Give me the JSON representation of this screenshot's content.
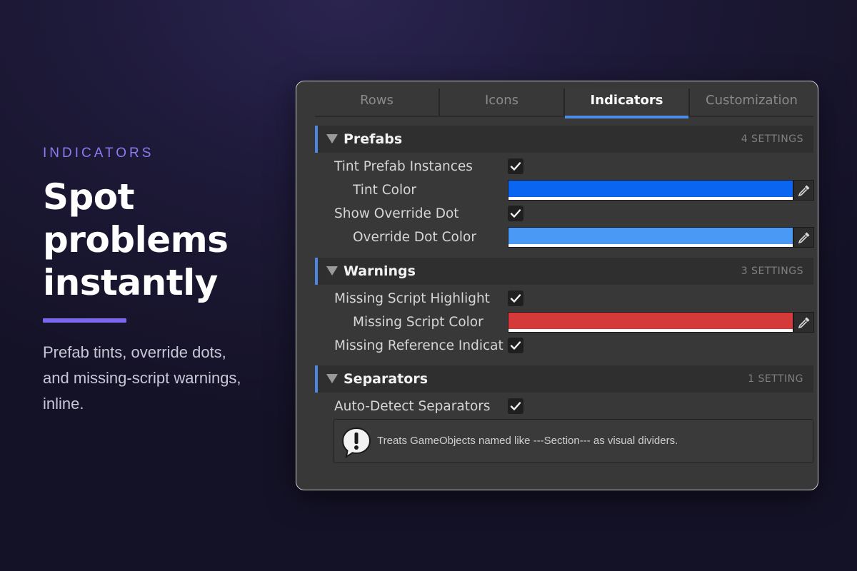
{
  "hero": {
    "eyebrow": "INDICATORS",
    "headline": [
      "Spot",
      "problems",
      "instantly"
    ],
    "blurb": [
      "Prefab tints, override dots,",
      "and missing-script warnings,",
      "inline."
    ]
  },
  "tabs": [
    {
      "label": "Rows",
      "active": false
    },
    {
      "label": "Icons",
      "active": false
    },
    {
      "label": "Indicators",
      "active": true
    },
    {
      "label": "Customization",
      "active": false
    }
  ],
  "sections": {
    "prefabs": {
      "title": "Prefabs",
      "count": "4 SETTINGS",
      "tint_prefab_instances": {
        "label": "Tint Prefab Instances",
        "checked": true
      },
      "tint_color": {
        "label": "Tint Color",
        "color": "#0a66f0"
      },
      "show_override_dot": {
        "label": "Show Override Dot",
        "checked": true
      },
      "override_dot_color": {
        "label": "Override Dot Color",
        "color": "#4a9af5"
      }
    },
    "warnings": {
      "title": "Warnings",
      "count": "3 SETTINGS",
      "missing_script_highlight": {
        "label": "Missing Script Highlight",
        "checked": true
      },
      "missing_script_color": {
        "label": "Missing Script Color",
        "color": "#d43a3a"
      },
      "missing_reference_indicator": {
        "label": "Missing Reference Indicat",
        "checked": true
      }
    },
    "separators": {
      "title": "Separators",
      "count": "1 SETTING",
      "auto_detect_separators": {
        "label": "Auto-Detect Separators",
        "checked": true
      },
      "help_text": "Treats GameObjects named like ---Section--- as visual dividers."
    }
  },
  "colors": {
    "accent": "#7a68f0",
    "section_bar": "#4d86e0",
    "active_tab_underline": "#4e8ae6"
  },
  "icons": {
    "checkbox": "checkmark-icon",
    "picker": "eyedropper-icon",
    "foldout": "triangle-down-icon",
    "help": "warning-bubble-icon"
  }
}
